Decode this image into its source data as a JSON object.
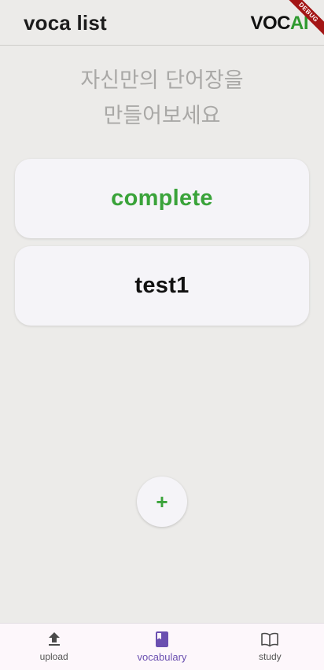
{
  "appbar": {
    "title": "voca list",
    "logo_voc": "VOC",
    "logo_ai": "AI",
    "debug_banner": "DEBUG"
  },
  "subtitle": {
    "line1": "자신만의 단어장을",
    "line2": "만들어보세요"
  },
  "voca_lists": [
    {
      "label": "complete",
      "color": "#3aa33a"
    },
    {
      "label": "test1",
      "color": "#111111"
    }
  ],
  "fab": {
    "label": "+"
  },
  "bottom_nav": {
    "items": [
      {
        "label": "upload",
        "icon": "upload-icon"
      },
      {
        "label": "vocabulary",
        "icon": "book-icon",
        "active": true
      },
      {
        "label": "study",
        "icon": "open-book-icon"
      }
    ],
    "active_color": "#6a4fb0"
  }
}
